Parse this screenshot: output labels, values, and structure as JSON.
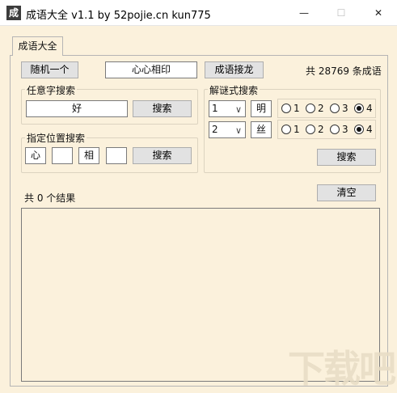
{
  "window": {
    "icon_text": "成",
    "title": "成语大全 v1.1 by 52pojie.cn kun775",
    "min_symbol": "—",
    "max_symbol": "☐",
    "close_symbol": "✕"
  },
  "tab": {
    "label": "成语大全"
  },
  "top": {
    "random_button": "随机一个",
    "current_idiom": "心心相印",
    "chain_button": "成语接龙",
    "total_text": "共 28769 条成语"
  },
  "any_search": {
    "group_label": "任意字搜索",
    "input_value": "好",
    "button": "搜索"
  },
  "position_search": {
    "group_label": "指定位置搜索",
    "chars": [
      "心",
      "",
      "相",
      ""
    ],
    "button": "搜索"
  },
  "riddle_search": {
    "group_label": "解谜式搜索",
    "rows": [
      {
        "select_value": "1",
        "char": "明",
        "options": [
          "1",
          "2",
          "3",
          "4"
        ],
        "selected": "4"
      },
      {
        "select_value": "2",
        "char": "丝",
        "options": [
          "1",
          "2",
          "3",
          "4"
        ],
        "selected": "4"
      }
    ],
    "button": "搜索"
  },
  "results": {
    "count_text": "共 0 个结果",
    "clear_button": "清空"
  },
  "watermark_text": "下载吧"
}
